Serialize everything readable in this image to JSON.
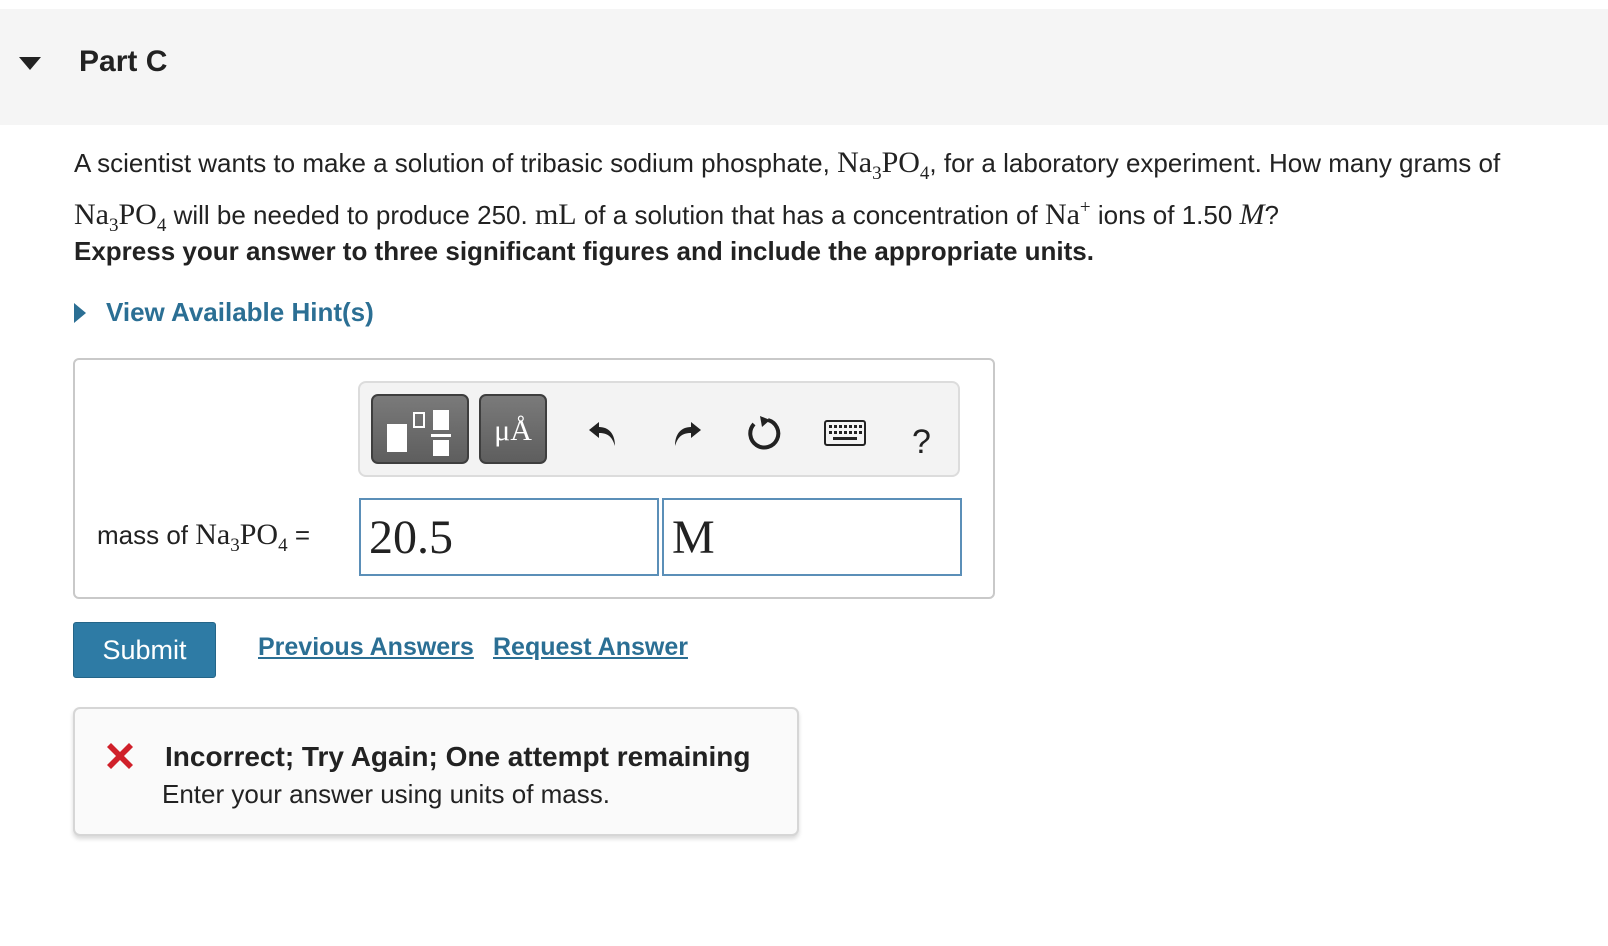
{
  "header": {
    "part_title": "Part C"
  },
  "question": {
    "line1_a": "A scientist wants to make a solution of tribasic sodium phosphate, ",
    "formula_na": "Na",
    "formula_3": "3",
    "formula_po": "PO",
    "formula_4": "4",
    "line1_b": ", for a laboratory experiment. How many grams of",
    "line2_a": " will be needed to produce 250. ",
    "volume_unit": "mL",
    "line2_b": " of a solution that has a concentration of ",
    "ion": "Na",
    "ion_charge": "+",
    "line2_c": " ions of 1.50 ",
    "molarity": "M",
    "line2_d": "?",
    "instruction": "Express your answer to three significant figures and include the appropriate units."
  },
  "hints": {
    "label": "View Available Hint(s)"
  },
  "toolbar": {
    "units_label": "μÅ",
    "help_label": "?"
  },
  "answer": {
    "label_prefix": "mass of ",
    "label_suffix": " =",
    "value": "20.5",
    "unit": "M"
  },
  "actions": {
    "submit_label": "Submit",
    "previous_answers": "Previous Answers",
    "request_answer": "Request Answer"
  },
  "feedback": {
    "title": "Incorrect; Try Again; One attempt remaining",
    "message": "Enter your answer using units of mass."
  },
  "colors": {
    "link": "#2b6f94",
    "submit": "#2e7ba5",
    "error": "#d0202a",
    "input_border": "#5b8fb8"
  }
}
